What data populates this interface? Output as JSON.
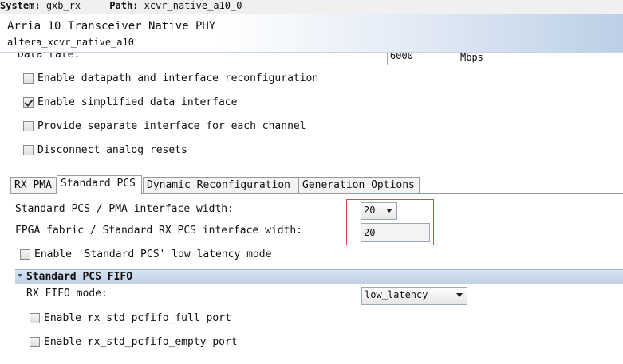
{
  "topbar": {
    "system_label": "System:",
    "system_value": "gxb_rx",
    "path_label": "Path:",
    "path_value": "xcvr_native_a10_0"
  },
  "header": {
    "title": "Arria 10 Transceiver Native PHY",
    "subtitle": "altera_xcvr_native_a10"
  },
  "data_rate": {
    "label": "Data rate:",
    "value": "6000",
    "unit": "Mbps"
  },
  "options": [
    {
      "label": "Enable datapath and interface reconfiguration",
      "checked": false
    },
    {
      "label": "Enable simplified data interface",
      "checked": true
    },
    {
      "label": "Provide separate interface for each channel",
      "checked": false
    },
    {
      "label": "Disconnect analog resets",
      "checked": false
    }
  ],
  "tabs": [
    {
      "label": "RX PMA",
      "active": false
    },
    {
      "label": "Standard PCS",
      "active": true
    },
    {
      "label": "Dynamic Reconfiguration",
      "active": false
    },
    {
      "label": "Generation Options",
      "active": false
    }
  ],
  "pcs": {
    "pma_width_label": "Standard PCS / PMA interface width:",
    "pma_width_value": "20",
    "fabric_width_label": "FPGA fabric / Standard RX PCS interface width:",
    "fabric_width_value": "20",
    "low_latency_label": "Enable 'Standard PCS' low latency mode",
    "low_latency_checked": false
  },
  "fifo": {
    "section_title": "Standard PCS FIFO",
    "mode_label": "RX FIFO mode:",
    "mode_value": "low_latency",
    "full_port_label": "Enable rx_std_pcfifo_full port",
    "full_port_checked": false,
    "empty_port_label": "Enable rx_std_pcfifo_empty port",
    "empty_port_checked": false
  },
  "colors": {
    "highlight_box": "#dd4444",
    "section_header": "#c9d8ea"
  }
}
